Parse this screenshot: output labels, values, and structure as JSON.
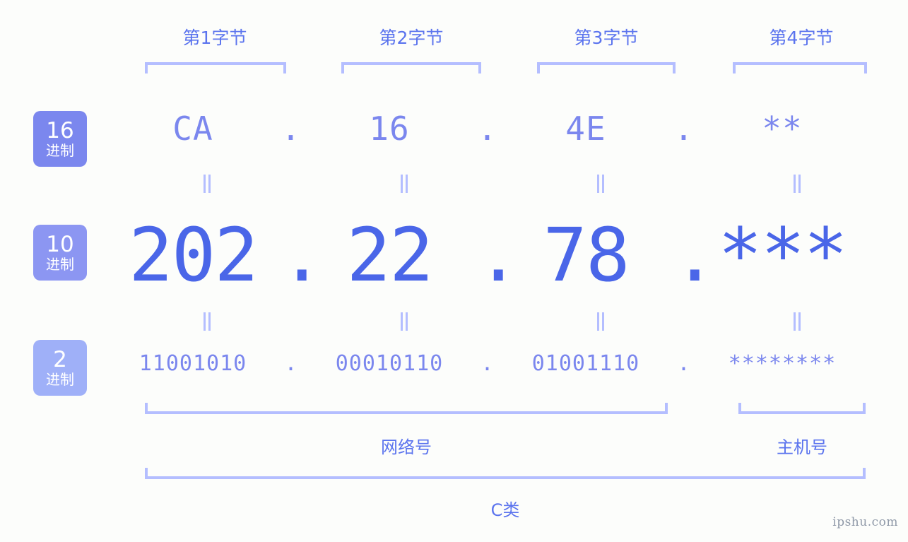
{
  "page": {
    "background_color": "#fcfdfb",
    "accent_strong": "#4a66e8",
    "accent_light": "#7b87ee",
    "bracket_color": "#b4beff",
    "watermark": "ipshu.com"
  },
  "byte_headers": [
    {
      "label": "第1字节"
    },
    {
      "label": "第2字节"
    },
    {
      "label": "第3字节"
    },
    {
      "label": "第4字节"
    }
  ],
  "radix_badges": [
    {
      "number": "16",
      "system": "进制",
      "color": "#7b87ee"
    },
    {
      "number": "10",
      "system": "进制",
      "color": "#8c96f2"
    },
    {
      "number": "2",
      "system": "进制",
      "color": "#9fb0f8"
    }
  ],
  "rows": {
    "hex": {
      "radix": "16",
      "separator": ".",
      "octets": [
        "CA",
        "16",
        "4E",
        "**"
      ]
    },
    "decimal": {
      "radix": "10",
      "separator": ".",
      "octets": [
        "202",
        "22",
        "78",
        "***"
      ]
    },
    "binary": {
      "radix": "2",
      "separator": ".",
      "octets": [
        "11001010",
        "00010110",
        "01001110",
        "********"
      ]
    }
  },
  "equality_marks": {
    "glyph": "||",
    "count_per_row": 4
  },
  "sections": {
    "network": {
      "label": "网络号"
    },
    "host": {
      "label": "主机号"
    },
    "class": {
      "label": "C类"
    }
  }
}
